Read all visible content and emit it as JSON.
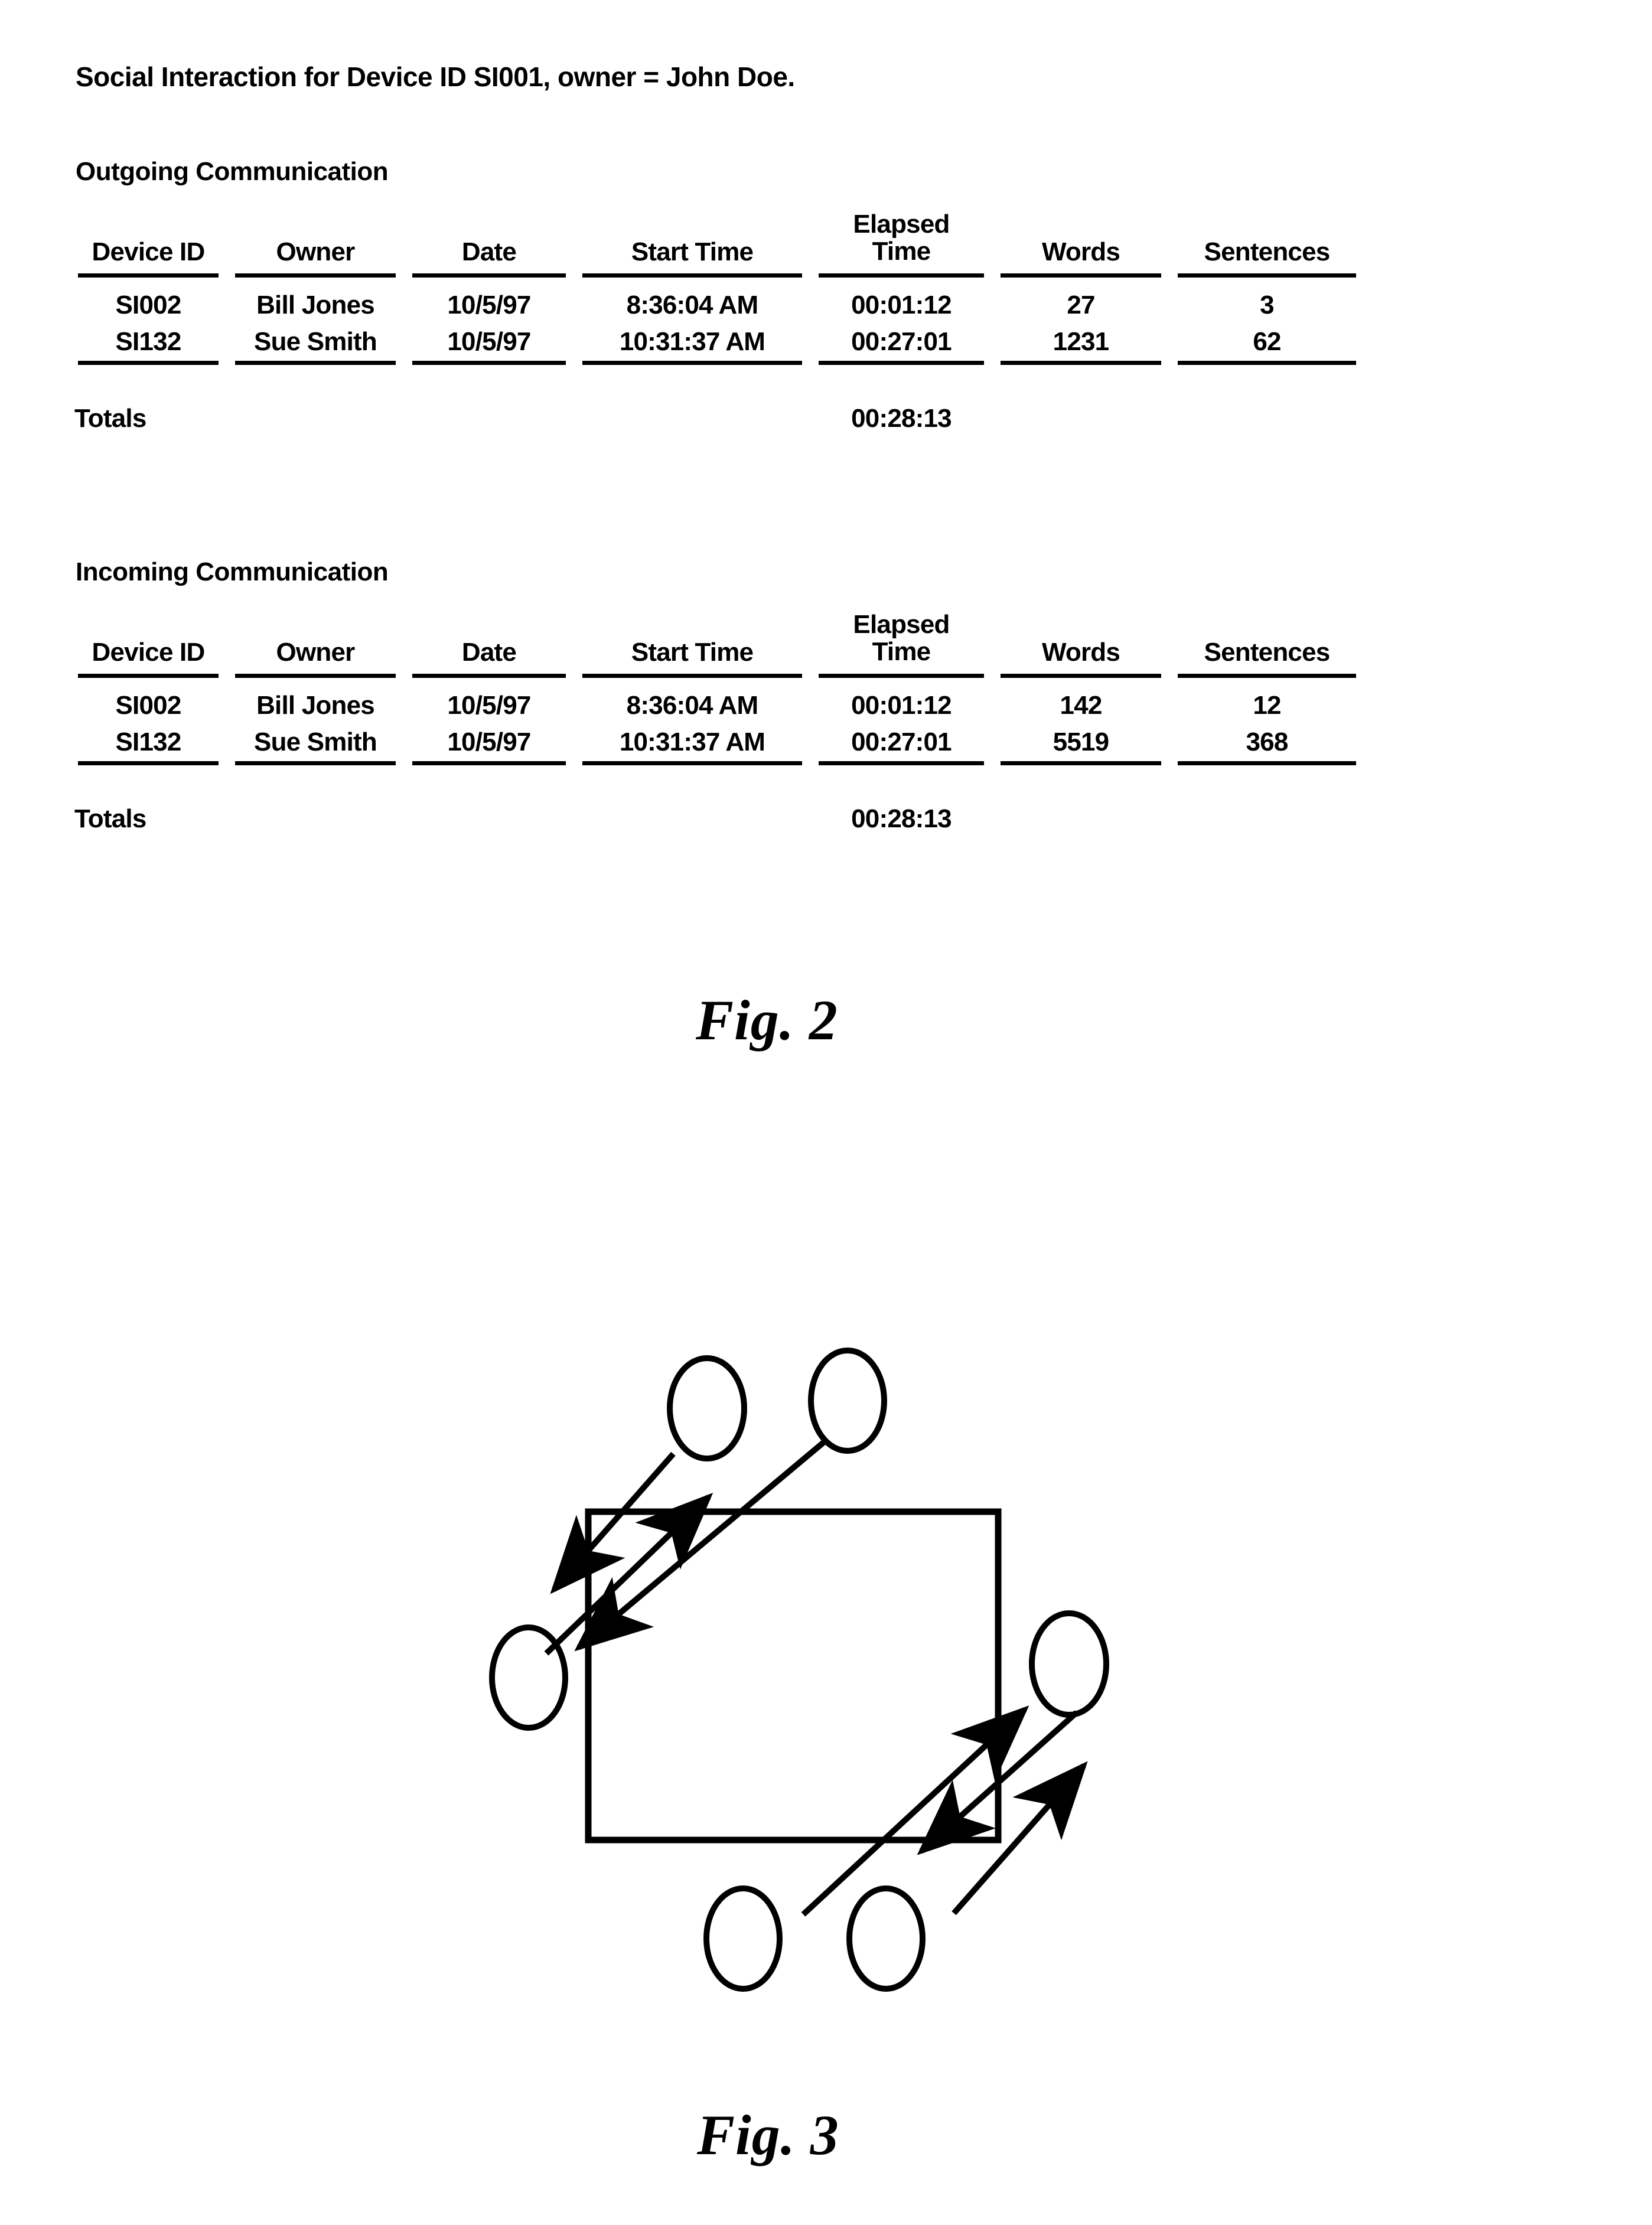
{
  "page": {
    "title": "Social Interaction for Device ID SI001, owner = John Doe."
  },
  "columns": [
    "Device ID",
    "Owner",
    "Date",
    "Start Time",
    "Elapsed Time",
    "Words",
    "Sentences"
  ],
  "column_headers": {
    "device_id": "Device ID",
    "owner": "Owner",
    "date": "Date",
    "start_time": "Start Time",
    "elapsed_time_line1": "Elapsed",
    "elapsed_time_line2": "Time",
    "words": "Words",
    "sentences": "Sentences"
  },
  "outgoing": {
    "heading": "Outgoing Communication",
    "rows": [
      {
        "device_id": "SI002",
        "owner": "Bill Jones",
        "date": "10/5/97",
        "start_time": "8:36:04 AM",
        "elapsed_time": "00:01:12",
        "words": "27",
        "sentences": "3"
      },
      {
        "device_id": "SI132",
        "owner": "Sue Smith",
        "date": "10/5/97",
        "start_time": "10:31:37 AM",
        "elapsed_time": "00:27:01",
        "words": "1231",
        "sentences": "62"
      }
    ],
    "totals": {
      "label": "Totals",
      "elapsed_time": "00:28:13"
    }
  },
  "incoming": {
    "heading": "Incoming Communication",
    "rows": [
      {
        "device_id": "SI002",
        "owner": "Bill Jones",
        "date": "10/5/97",
        "start_time": "8:36:04 AM",
        "elapsed_time": "00:01:12",
        "words": "142",
        "sentences": "12"
      },
      {
        "device_id": "SI132",
        "owner": "Sue Smith",
        "date": "10/5/97",
        "start_time": "10:31:37 AM",
        "elapsed_time": "00:27:01",
        "words": "5519",
        "sentences": "368"
      }
    ],
    "totals": {
      "label": "Totals",
      "elapsed_time": "00:28:13"
    }
  },
  "figures": {
    "fig2_caption": "Fig.  2",
    "fig3_caption": "Fig.  3"
  },
  "colors": {
    "ink": "#000000",
    "paper": "#ffffff"
  }
}
